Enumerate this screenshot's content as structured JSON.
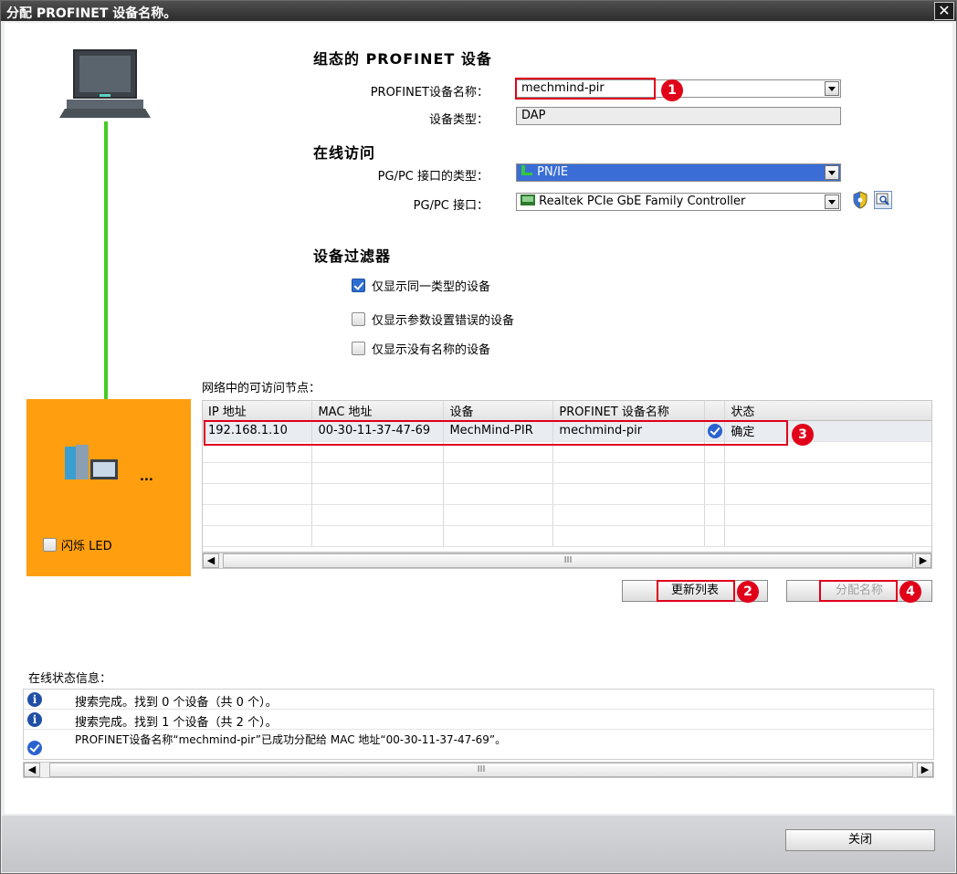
{
  "window": {
    "title": "分配 PROFINET 设备名称。",
    "close_glyph": "✕"
  },
  "configured": {
    "heading": "组态的 PROFINET 设备",
    "name_label": "PROFINET设备名称：",
    "name_value": "mechmind-pir",
    "type_label": "设备类型：",
    "type_value": "DAP"
  },
  "online": {
    "heading": "在线访问",
    "pgpc_type_label": "PG/PC 接口的类型：",
    "pgpc_type_value": "PN/IE",
    "pgpc_if_label": "PG/PC 接口：",
    "pgpc_if_value": "Realtek PCIe GbE Family Controller"
  },
  "filter": {
    "heading": "设备过滤器",
    "items": [
      {
        "label": "仅显示同一类型的设备",
        "checked": true
      },
      {
        "label": "仅显示参数设置错误的设备",
        "checked": false
      },
      {
        "label": "仅显示没有名称的设备",
        "checked": false
      }
    ]
  },
  "left_panel": {
    "flash_led_label": "闪烁 LED",
    "device_ellipsis": "..."
  },
  "nodes": {
    "heading": "网络中的可访问节点：",
    "columns": [
      "IP 地址",
      "MAC 地址",
      "设备",
      "PROFINET 设备名称",
      "状态"
    ],
    "rows": [
      {
        "ip": "192.168.1.10",
        "mac": "00-30-11-37-47-69",
        "device": "MechMind-PIR",
        "name": "mechmind-pir",
        "status": "确定"
      }
    ],
    "scroll_thumb": "III"
  },
  "buttons": {
    "update_list": "更新列表",
    "assign_name": "分配名称",
    "close": "关闭"
  },
  "callouts": [
    "1",
    "2",
    "3",
    "4"
  ],
  "status": {
    "heading": "在线状态信息：",
    "messages": [
      {
        "icon": "info",
        "text": "搜索完成。找到 0 个设备（共 0 个）。"
      },
      {
        "icon": "info",
        "text": "搜索完成。找到 1 个设备（共 2 个）。"
      },
      {
        "icon": "ok",
        "text": "PROFINET设备名称“mechmind-pir”已成功分配给 MAC 地址“00-30-11-37-47-69”。"
      }
    ],
    "scroll_thumb": "III"
  },
  "colors": {
    "accent_red": "#e0001a",
    "selection_blue": "#3a6ed6",
    "panel_orange": "#ff9f0f",
    "link_green": "#44cc22"
  }
}
